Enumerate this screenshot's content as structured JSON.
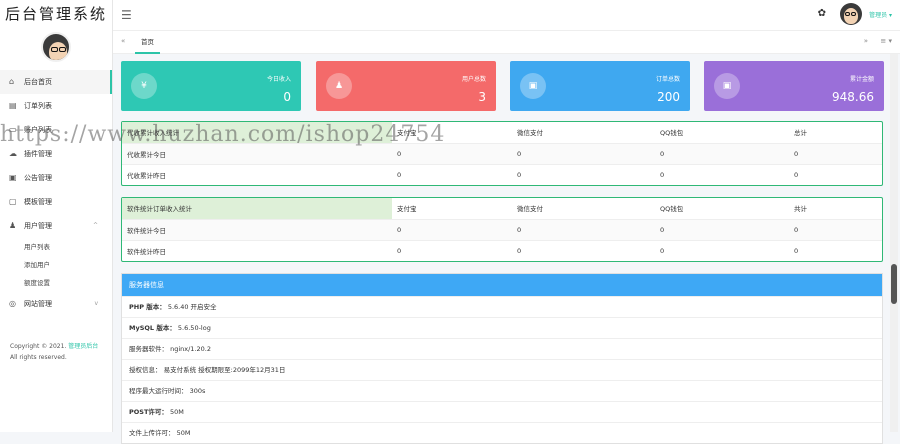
{
  "app": {
    "title": "后台管理系统"
  },
  "sidebar": {
    "items": [
      {
        "label": "后台首页",
        "icon": "home-icon"
      },
      {
        "label": "订单列表",
        "icon": "list-icon"
      },
      {
        "label": "账户列表",
        "icon": "wallet-icon"
      },
      {
        "label": "插件管理",
        "icon": "plugin-icon"
      },
      {
        "label": "公告管理",
        "icon": "announce-icon"
      },
      {
        "label": "模板管理",
        "icon": "template-icon"
      },
      {
        "label": "用户管理",
        "icon": "user-icon"
      }
    ],
    "subitems": [
      "用户列表",
      "添加用户",
      "额度设置"
    ],
    "site": {
      "label": "网站管理"
    },
    "copyright_line1": "Copyright © 2021.",
    "copyright_link": "管理员后台",
    "copyright_line2": "All rights reserved."
  },
  "topbar": {
    "admin_name": "管理员"
  },
  "tabs": {
    "home": "首页"
  },
  "stats": [
    {
      "label": "今日收入",
      "value": "0",
      "color": "#2ec8b4",
      "icon": "yen-icon"
    },
    {
      "label": "用户总数",
      "value": "3",
      "color": "#f46a6a",
      "icon": "person-icon"
    },
    {
      "label": "订单总数",
      "value": "200",
      "color": "#3fa8f0",
      "icon": "card-icon"
    },
    {
      "label": "累计金额",
      "value": "948.66",
      "color": "#9a6fd9",
      "icon": "card-icon"
    }
  ],
  "table1": {
    "header": [
      "代收累计收入统计",
      "支付宝",
      "微信支付",
      "QQ钱包",
      "总计"
    ],
    "rows": [
      [
        "代收累计今日",
        "0",
        "0",
        "0",
        "0"
      ],
      [
        "代收累计昨日",
        "0",
        "0",
        "0",
        "0"
      ]
    ]
  },
  "table2": {
    "header": [
      "软件统计订单收入统计",
      "支付宝",
      "微信支付",
      "QQ钱包",
      "共计"
    ],
    "rows": [
      [
        "软件统计今日",
        "0",
        "0",
        "0",
        "0"
      ],
      [
        "软件统计昨日",
        "0",
        "0",
        "0",
        "0"
      ]
    ]
  },
  "server": {
    "title": "服务器信息",
    "rows": [
      {
        "key": "PHP 版本：",
        "val": "5.6.40 开启安全"
      },
      {
        "key": "MySQL 版本：",
        "val": "5.6.50-log"
      },
      {
        "key": "服务器软件：",
        "val": "nginx/1.20.2"
      },
      {
        "key": "授权信息：",
        "val": "易支付系统 授权期限至:2099年12月31日"
      },
      {
        "key": "程序最大运行时间：",
        "val": "300s"
      },
      {
        "key": "POST许可：",
        "val": "50M"
      },
      {
        "key": "文件上传许可：",
        "val": "50M"
      }
    ]
  },
  "watermark": "https://www.huzhan.com/ishop24754"
}
